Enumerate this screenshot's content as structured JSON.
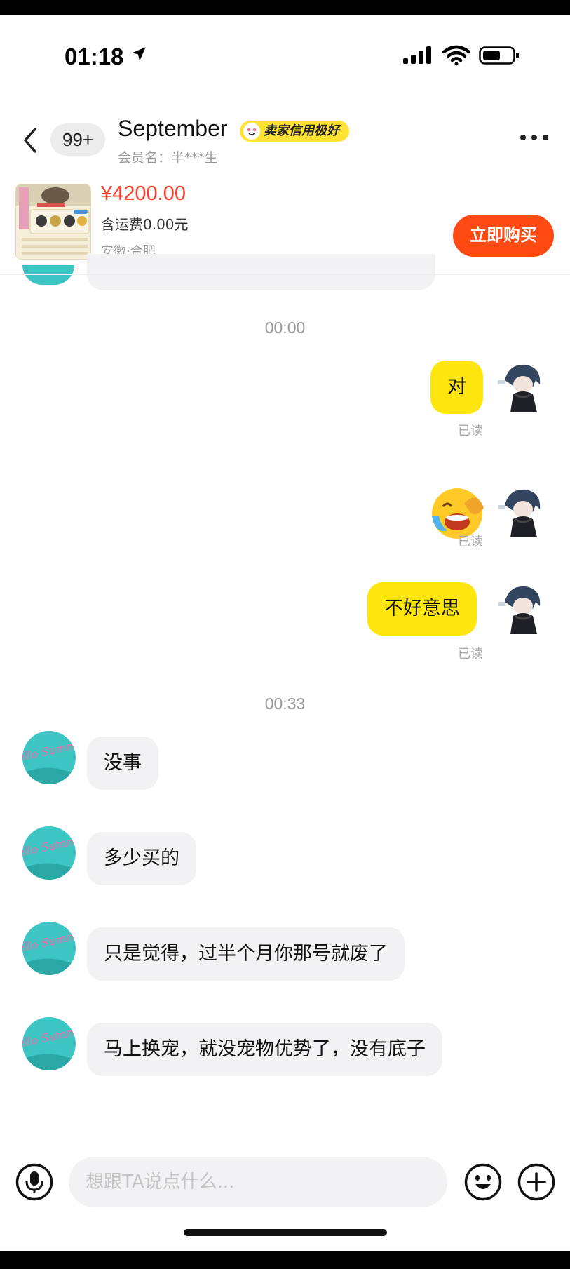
{
  "status_bar": {
    "time": "01:18"
  },
  "header": {
    "unread_count": "99+",
    "contact_name": "September",
    "credit_badge": "卖家信用极好",
    "member_line": "会员名：半***生"
  },
  "product": {
    "price": "¥4200.00",
    "shipping": "含运费0.00元",
    "location": "安徽·合肥",
    "buy_label": "立即购买"
  },
  "chat": {
    "time_1": "00:00",
    "outgoing": [
      {
        "text": "对",
        "status": "已读"
      },
      {
        "emoji": "crying-laughing-emoji",
        "status": "已读"
      },
      {
        "text": "不好意思",
        "status": "已读"
      }
    ],
    "time_2": "00:33",
    "incoming": [
      {
        "text": "没事"
      },
      {
        "text": "多少买的"
      },
      {
        "text": "只是觉得，过半个月你那号就废了"
      },
      {
        "text": "马上换宠，就没宠物优势了，没有底子"
      }
    ]
  },
  "input_bar": {
    "placeholder": "想跟TA说点什么..."
  },
  "avatar_peer_text": "Hello Summer",
  "colors": {
    "accent_yellow": "#ffe60f",
    "buy_orange": "#ff4a13",
    "price_red": "#ff3d2e"
  }
}
